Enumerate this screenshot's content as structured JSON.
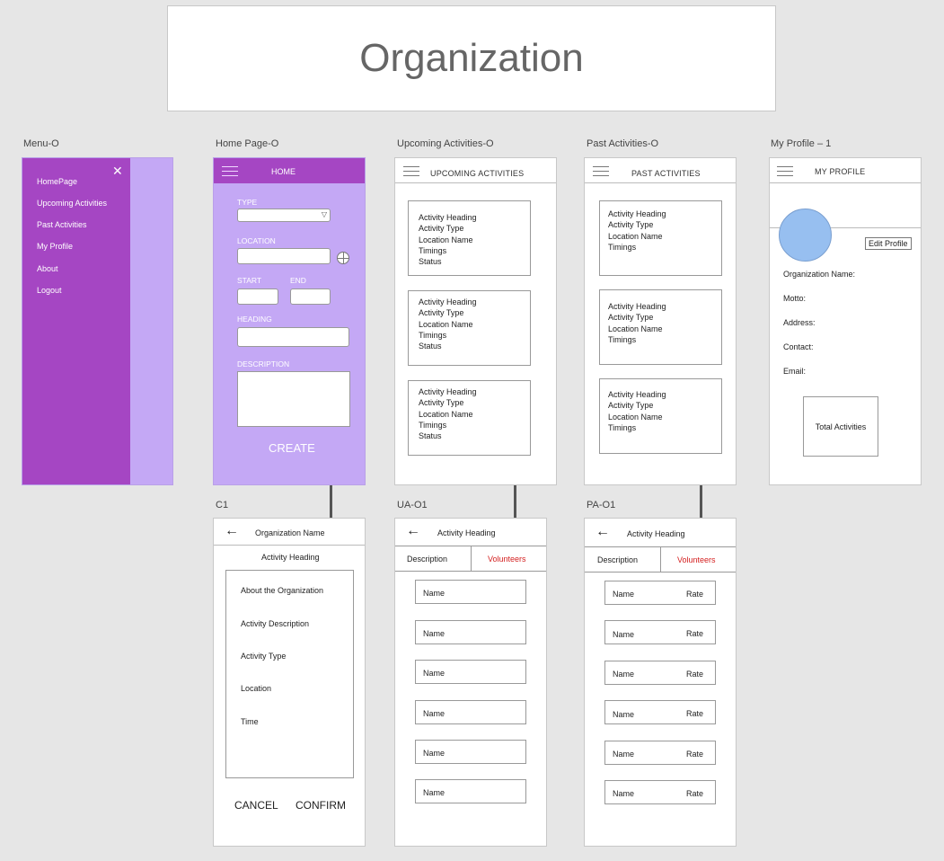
{
  "title": "Organization",
  "labels": {
    "menu": "Menu-O",
    "home": "Home Page-O",
    "upcoming": "Upcoming Activities-O",
    "past": "Past Activities-O",
    "profile": "My Profile – 1",
    "c1": "C1",
    "ua": "UA-O1",
    "pa": "PA-O1"
  },
  "menu": {
    "close": "✕",
    "items": [
      "HomePage",
      "Upcoming Activities",
      "Past Activities",
      "My Profile",
      "About",
      "Logout"
    ]
  },
  "home": {
    "header": "HOME",
    "type": "TYPE",
    "location": "LOCATION",
    "start": "START",
    "end": "END",
    "heading": "HEADING",
    "description": "DESCRIPTION",
    "create": "CREATE"
  },
  "upcoming": {
    "header": "UPCOMING ACTIVITIES",
    "cards": [
      [
        "Activity Heading",
        "Activity Type",
        "Location Name",
        "Timings",
        "Status"
      ],
      [
        "Activity Heading",
        "Activity Type",
        "Location Name",
        "Timings",
        "Status"
      ],
      [
        "Activity Heading",
        "Activity Type",
        "Location Name",
        "Timings",
        "Status"
      ]
    ]
  },
  "past": {
    "header": "PAST ACTIVITIES",
    "cards": [
      [
        "Activity Heading",
        "Activity Type",
        "Location Name",
        "Timings"
      ],
      [
        "Activity Heading",
        "Activity Type",
        "Location Name",
        "Timings"
      ],
      [
        "Activity Heading",
        "Activity Type",
        "Location Name",
        "Timings"
      ]
    ]
  },
  "profile": {
    "header": "MY PROFILE",
    "edit": "Edit Profile",
    "fields": [
      "Organization Name:",
      "Motto:",
      "Address:",
      "Contact:",
      "Email:"
    ],
    "total": "Total Activities"
  },
  "c1": {
    "back": "←",
    "org": "Organization Name",
    "heading": "Activity Heading",
    "items": [
      "About the Organization",
      "Activity Description",
      "Activity Type",
      "Location",
      "Time"
    ],
    "cancel": "CANCEL",
    "confirm": "CONFIRM"
  },
  "ua": {
    "back": "←",
    "heading": "Activity Heading",
    "tab_desc": "Description",
    "tab_vol": "Volunteers",
    "names": [
      "Name",
      "Name",
      "Name",
      "Name",
      "Name",
      "Name"
    ]
  },
  "pa": {
    "back": "←",
    "heading": "Activity Heading",
    "tab_desc": "Description",
    "tab_vol": "Volunteers",
    "rows": [
      {
        "name": "Name",
        "rate": "Rate"
      },
      {
        "name": "Name",
        "rate": "Rate"
      },
      {
        "name": "Name",
        "rate": "Rate"
      },
      {
        "name": "Name",
        "rate": "Rate"
      },
      {
        "name": "Name",
        "rate": "Rate"
      },
      {
        "name": "Name",
        "rate": "Rate"
      }
    ]
  },
  "colors": {
    "menu_purple": "#a546c3",
    "menu_light": "#c4a8f5",
    "home_bg": "#c4a8f5",
    "home_header": "#a546c3",
    "avatar": "#97bff0",
    "volunteers_red": "#d42020"
  }
}
